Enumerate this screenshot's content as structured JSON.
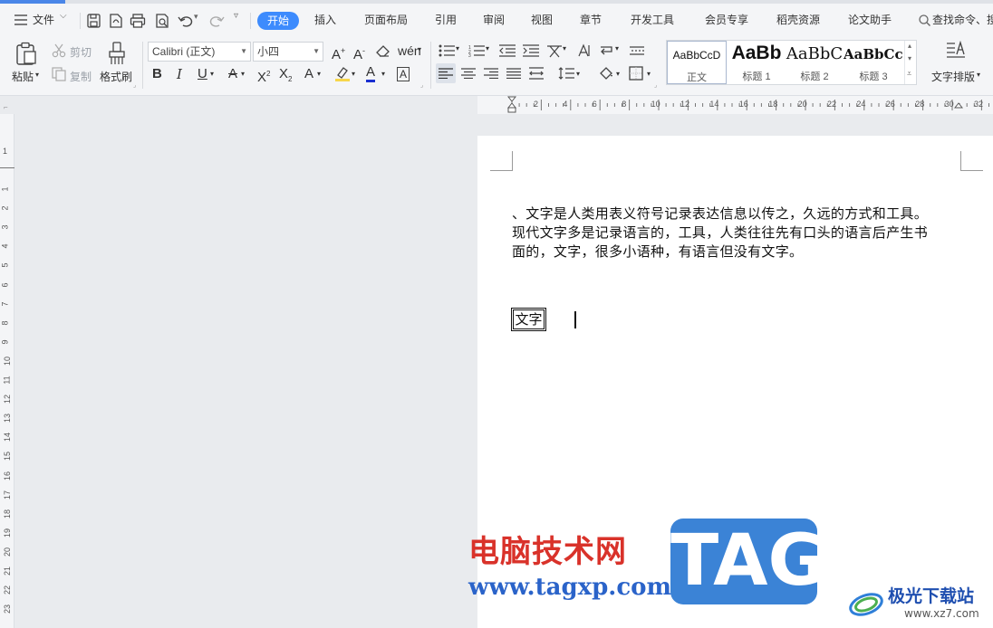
{
  "menu": {
    "file_label": "文件",
    "tabs": [
      "开始",
      "插入",
      "页面布局",
      "引用",
      "审阅",
      "视图",
      "章节",
      "开发工具",
      "会员专享",
      "稻壳资源",
      "论文助手"
    ],
    "search_label": "查找命令、搜"
  },
  "ribbon": {
    "paste_label": "粘贴",
    "cut_label": "剪切",
    "copy_label": "复制",
    "format_painter_label": "格式刷",
    "font_name": "Calibri (正文)",
    "font_size": "小四",
    "styles": [
      {
        "sample": "AaBbCcD",
        "name": "正文"
      },
      {
        "sample": "AaBb",
        "name": "标题 1"
      },
      {
        "sample": "AaBbC",
        "name": "标题 2"
      },
      {
        "sample": "AaBbCcI",
        "name": "标题 3"
      }
    ],
    "text_layout_label": "文字排版"
  },
  "ruler": {
    "h_numbers": [
      "2",
      "4",
      "6",
      "8",
      "10",
      "12",
      "14",
      "16",
      "18",
      "20",
      "22",
      "24",
      "26",
      "28",
      "30",
      "32"
    ],
    "v_numbers": [
      "1",
      "1",
      "2",
      "3",
      "4",
      "5",
      "6",
      "7",
      "8",
      "9",
      "10",
      "11",
      "12",
      "13",
      "14",
      "15",
      "16",
      "17",
      "18",
      "19",
      "20",
      "21",
      "22",
      "23"
    ]
  },
  "document": {
    "lines": [
      "、文字是人类用表义符号记录表达信息以传之，久远的方式和工具。",
      "现代文字多是记录语言的，工具，人类往往先有口头的语言后产生书",
      "面的，文字，很多小语种，有语言但没有文字。"
    ],
    "boxed_text": "文字"
  },
  "watermark": {
    "site_name": "电脑技术网",
    "site_url": "www.tagxp.com",
    "tag_logo": "TAG",
    "brand": "极光下载站",
    "brand_url": "www.xz7.com"
  },
  "colors": {
    "accent": "#3d8bfd",
    "watermark_red": "#d9322a",
    "watermark_blue": "#3b83d6"
  }
}
